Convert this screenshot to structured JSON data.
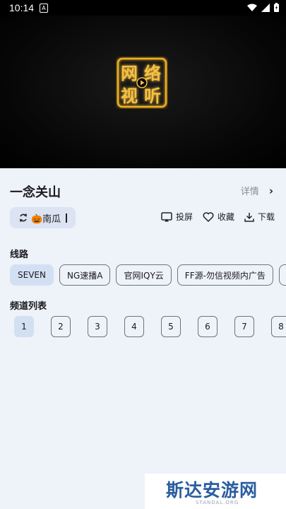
{
  "status_bar": {
    "time": "10:14"
  },
  "player": {
    "logo_chars": [
      "网",
      "络",
      "视",
      "听"
    ]
  },
  "info": {
    "title": "一念关山",
    "detail_label": "详情",
    "source_label": "🎃南瓜",
    "actions": {
      "cast": "投屏",
      "favorite": "收藏",
      "download": "下载"
    }
  },
  "routes": {
    "label": "线路",
    "items": [
      "SEVEN",
      "NG速播A",
      "官网IQY云",
      "FF源-勿信视频内广告"
    ],
    "selected": 0
  },
  "episodes": {
    "label": "频道列表",
    "items": [
      "1",
      "2",
      "3",
      "4",
      "5",
      "6",
      "7",
      "8"
    ],
    "selected": 0
  },
  "watermark": {
    "main": "斯达安游网",
    "sub": "STANDAL.ORG"
  },
  "colors": {
    "accent_chip": "#d3e0f4",
    "background": "#eef2f9",
    "logo_gold": "#f0b020"
  }
}
